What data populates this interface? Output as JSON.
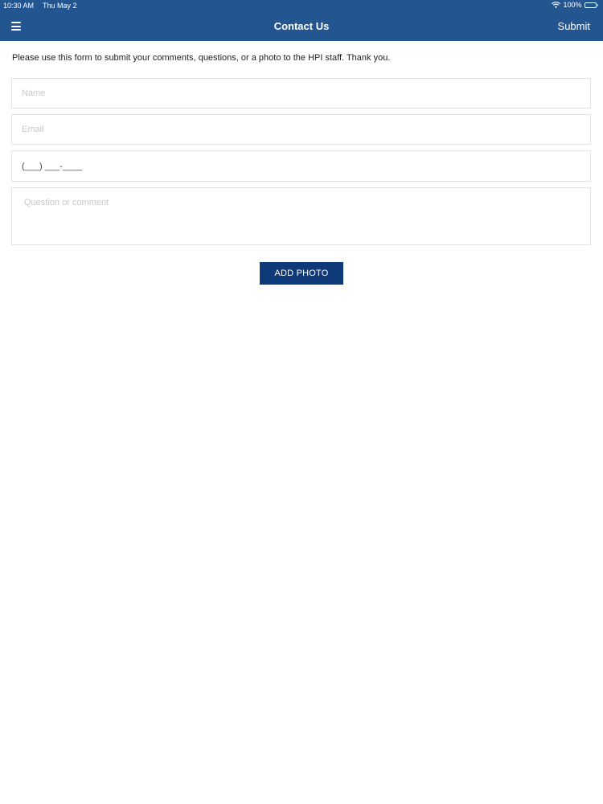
{
  "status_bar": {
    "time": "10:30 AM",
    "date": "Thu May 2",
    "battery": "100%",
    "wifi_icon": "wifi-icon",
    "battery_icon": "battery-icon"
  },
  "nav": {
    "menu_icon": "hamburger-menu-icon",
    "title": "Contact Us",
    "submit_label": "Submit"
  },
  "form": {
    "intro": "Please use this form to submit your comments, questions, or a photo to the HPI staff. Thank you.",
    "name_placeholder": "Name",
    "email_placeholder": "Email",
    "phone_value": "(___) ___-____",
    "comment_placeholder": "Question or comment",
    "add_photo_label": "ADD PHOTO"
  },
  "colors": {
    "header": "#235591",
    "button": "#0e3a7a",
    "background": "#ffffff"
  }
}
